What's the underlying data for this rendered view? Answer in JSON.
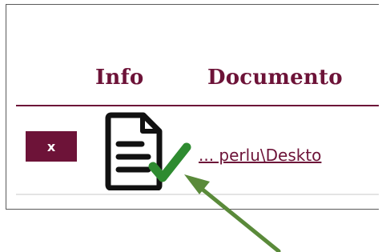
{
  "table": {
    "headers": {
      "info": "Info",
      "documento": "Documento"
    },
    "rows": [
      {
        "delete_label": "x",
        "info_icon": "document-check-icon",
        "document_link": "... perlu\\Deskto"
      }
    ]
  },
  "colors": {
    "accent": "#6d1338",
    "check": "#2e8b30",
    "annotation_arrow": "#5a8a3a",
    "row_divider": "#e4e4e4",
    "frame_border": "#5a5a5a"
  },
  "annotation": {
    "icon": "pointer-arrow-icon"
  }
}
